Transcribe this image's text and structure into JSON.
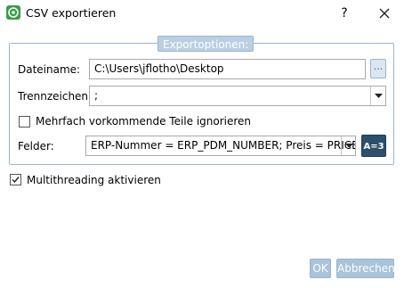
{
  "window": {
    "title": "CSV exportieren",
    "help_label": "?"
  },
  "group": {
    "title": "Exportoptionen:"
  },
  "filename": {
    "label": "Dateiname:",
    "value": "C:\\Users\\jflotho\\Desktop",
    "browse_label": "..."
  },
  "separator": {
    "label": "Trennzeichen:",
    "value": ";"
  },
  "ignore_duplicates": {
    "label": "Mehrfach vorkommende Teile ignorieren",
    "checked": false
  },
  "fields": {
    "label": "Felder:",
    "value": "ERP-Nummer = ERP_PDM_NUMBER; Preis = PRICE;  :",
    "mapping_button": "A=3"
  },
  "multithreading": {
    "label": "Multithreading aktivieren",
    "checked": true
  },
  "buttons": {
    "ok": "OK",
    "cancel": "Abbrechen"
  },
  "colors": {
    "accent": "#9ab6cf",
    "button_fill": "#a9c3d8",
    "dark_button": "#2c4f6b"
  }
}
